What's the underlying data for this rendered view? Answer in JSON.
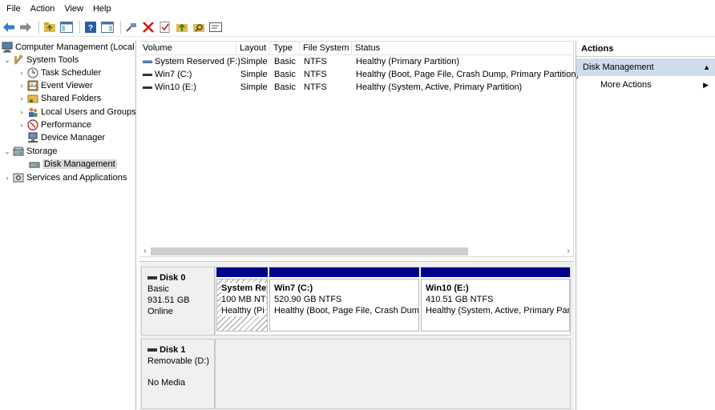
{
  "menu": [
    "File",
    "Action",
    "View",
    "Help"
  ],
  "tree": {
    "root": "Computer Management (Local",
    "system_tools": "System Tools",
    "task_scheduler": "Task Scheduler",
    "event_viewer": "Event Viewer",
    "shared_folders": "Shared Folders",
    "local_users": "Local Users and Groups",
    "performance": "Performance",
    "device_manager": "Device Manager",
    "storage": "Storage",
    "disk_management": "Disk Management",
    "services_apps": "Services and Applications"
  },
  "volume_list": {
    "columns": [
      "Volume",
      "Layout",
      "Type",
      "File System",
      "Status"
    ],
    "rows": [
      {
        "volume": "System Reserved (F:)",
        "layout": "Simple",
        "type": "Basic",
        "fs": "NTFS",
        "status": "Healthy (Primary Partition)"
      },
      {
        "volume": "Win7 (C:)",
        "layout": "Simple",
        "type": "Basic",
        "fs": "NTFS",
        "status": "Healthy (Boot, Page File, Crash Dump, Primary Partition)"
      },
      {
        "volume": "Win10 (E:)",
        "layout": "Simple",
        "type": "Basic",
        "fs": "NTFS",
        "status": "Healthy (System, Active, Primary Partition)"
      }
    ]
  },
  "disks": [
    {
      "name": "Disk 0",
      "type": "Basic",
      "size": "931.51 GB",
      "state": "Online",
      "partitions": [
        {
          "name": "System Re",
          "size": "100 MB NT",
          "status": "Healthy (Pi"
        },
        {
          "name": "Win7  (C:)",
          "size": "520.90 GB NTFS",
          "status": "Healthy (Boot, Page File, Crash Dum"
        },
        {
          "name": "Win10  (E:)",
          "size": "410.51 GB NTFS",
          "status": "Healthy (System, Active, Primary Par"
        }
      ]
    },
    {
      "name": "Disk 1",
      "type": "Removable (D:)",
      "state": "No Media"
    }
  ],
  "actions": {
    "title": "Actions",
    "section": "Disk Management",
    "more": "More Actions"
  },
  "colors": {
    "partition_bar": "#00008b",
    "action_section_bg": "#cfdcec"
  }
}
